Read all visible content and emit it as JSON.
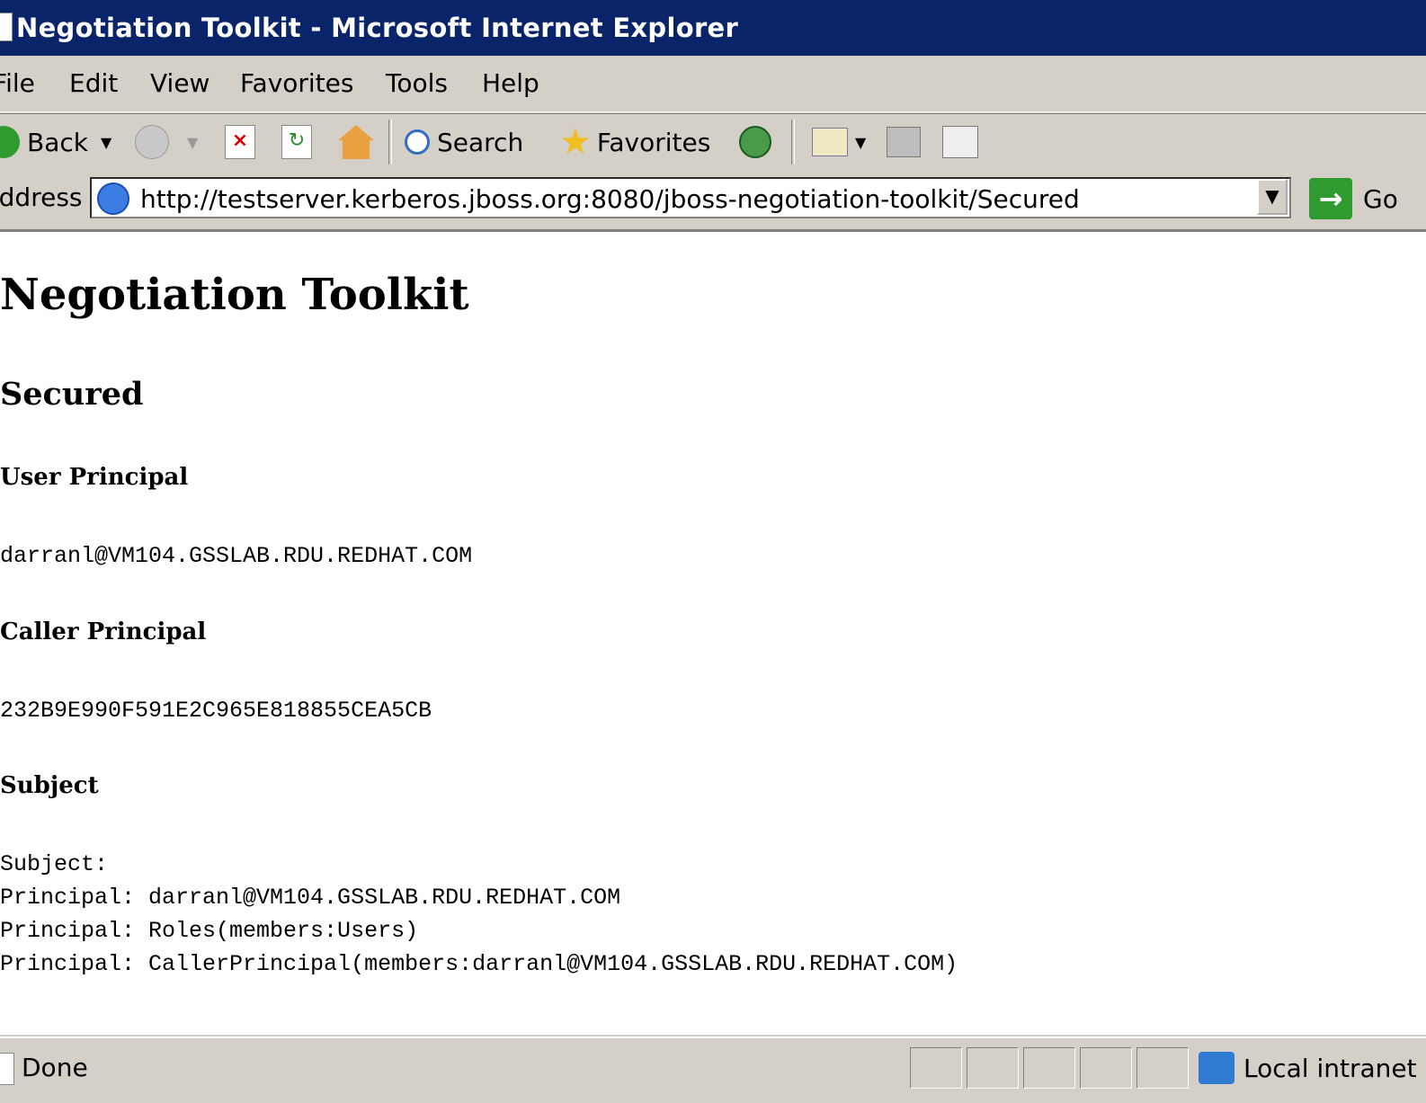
{
  "window": {
    "title": "Negotiation Toolkit - Microsoft Internet Explorer"
  },
  "menu": [
    "File",
    "Edit",
    "View",
    "Favorites",
    "Tools",
    "Help"
  ],
  "toolbar": {
    "back_label": "Back",
    "search_label": "Search",
    "favorites_label": "Favorites"
  },
  "address": {
    "label": "Address",
    "url": "http://testserver.kerberos.jboss.org:8080/jboss-negotiation-toolkit/Secured",
    "go_label": "Go"
  },
  "page": {
    "title": "Negotiation Toolkit",
    "subtitle": "Secured",
    "user_principal_heading": "User Principal",
    "user_principal_value": "darranl@VM104.GSSLAB.RDU.REDHAT.COM",
    "caller_principal_heading": "Caller Principal",
    "caller_principal_value": "232B9E990F591E2C965E818855CEA5CB",
    "subject_heading": "Subject",
    "subject_lines": [
      "Subject:",
      "Principal: darranl@VM104.GSSLAB.RDU.REDHAT.COM",
      "Principal: Roles(members:Users)",
      "Principal: CallerPrincipal(members:darranl@VM104.GSSLAB.RDU.REDHAT.COM)"
    ]
  },
  "status": {
    "text": "Done",
    "zone": "Local intranet"
  },
  "colors": {
    "titlebar": "#0a246a",
    "chrome": "#d4d0c8",
    "go": "#2f9a2f"
  }
}
